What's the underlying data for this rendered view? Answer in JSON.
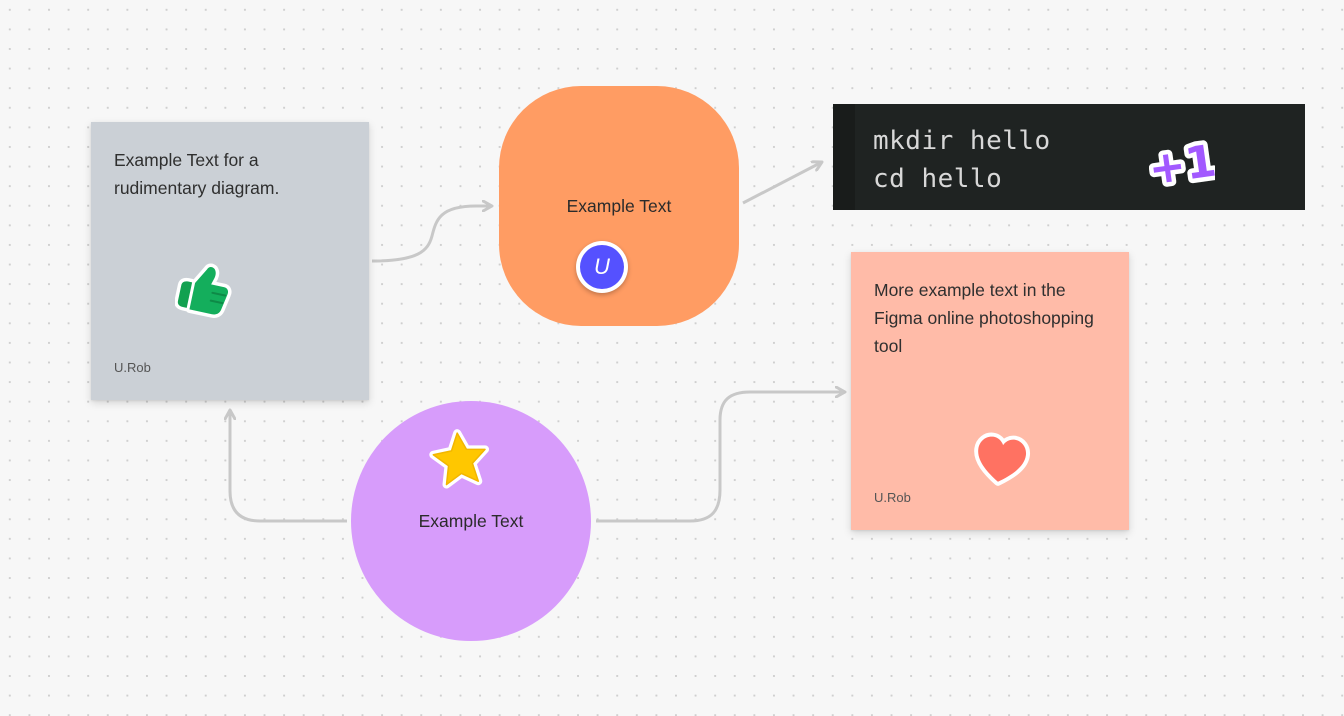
{
  "notes": {
    "gray": {
      "text": "Example Text for a rudimentary diagram.",
      "author": "U.Rob",
      "color": "#cbd0d6",
      "sticker": "thumbs-up-icon"
    },
    "pink": {
      "text": "More example text in the Figma online photoshopping tool",
      "author": "U.Rob",
      "color": "#ffbba8",
      "sticker": "heart-icon"
    }
  },
  "shapes": {
    "orange": {
      "label": "Example Text",
      "color": "#ff9c63",
      "avatar_initial": "U",
      "avatar_color": "#5551ff"
    },
    "purple": {
      "label": "Example Text",
      "color": "#d79cfb",
      "sticker": "star-icon"
    }
  },
  "code_block": {
    "lines": [
      "mkdir hello",
      "cd hello"
    ],
    "background": "#1f2322",
    "sticker": "plus-one-icon",
    "sticker_text": "+1",
    "sticker_color": "#a259ff"
  },
  "connector_color": "#c8c8c8"
}
